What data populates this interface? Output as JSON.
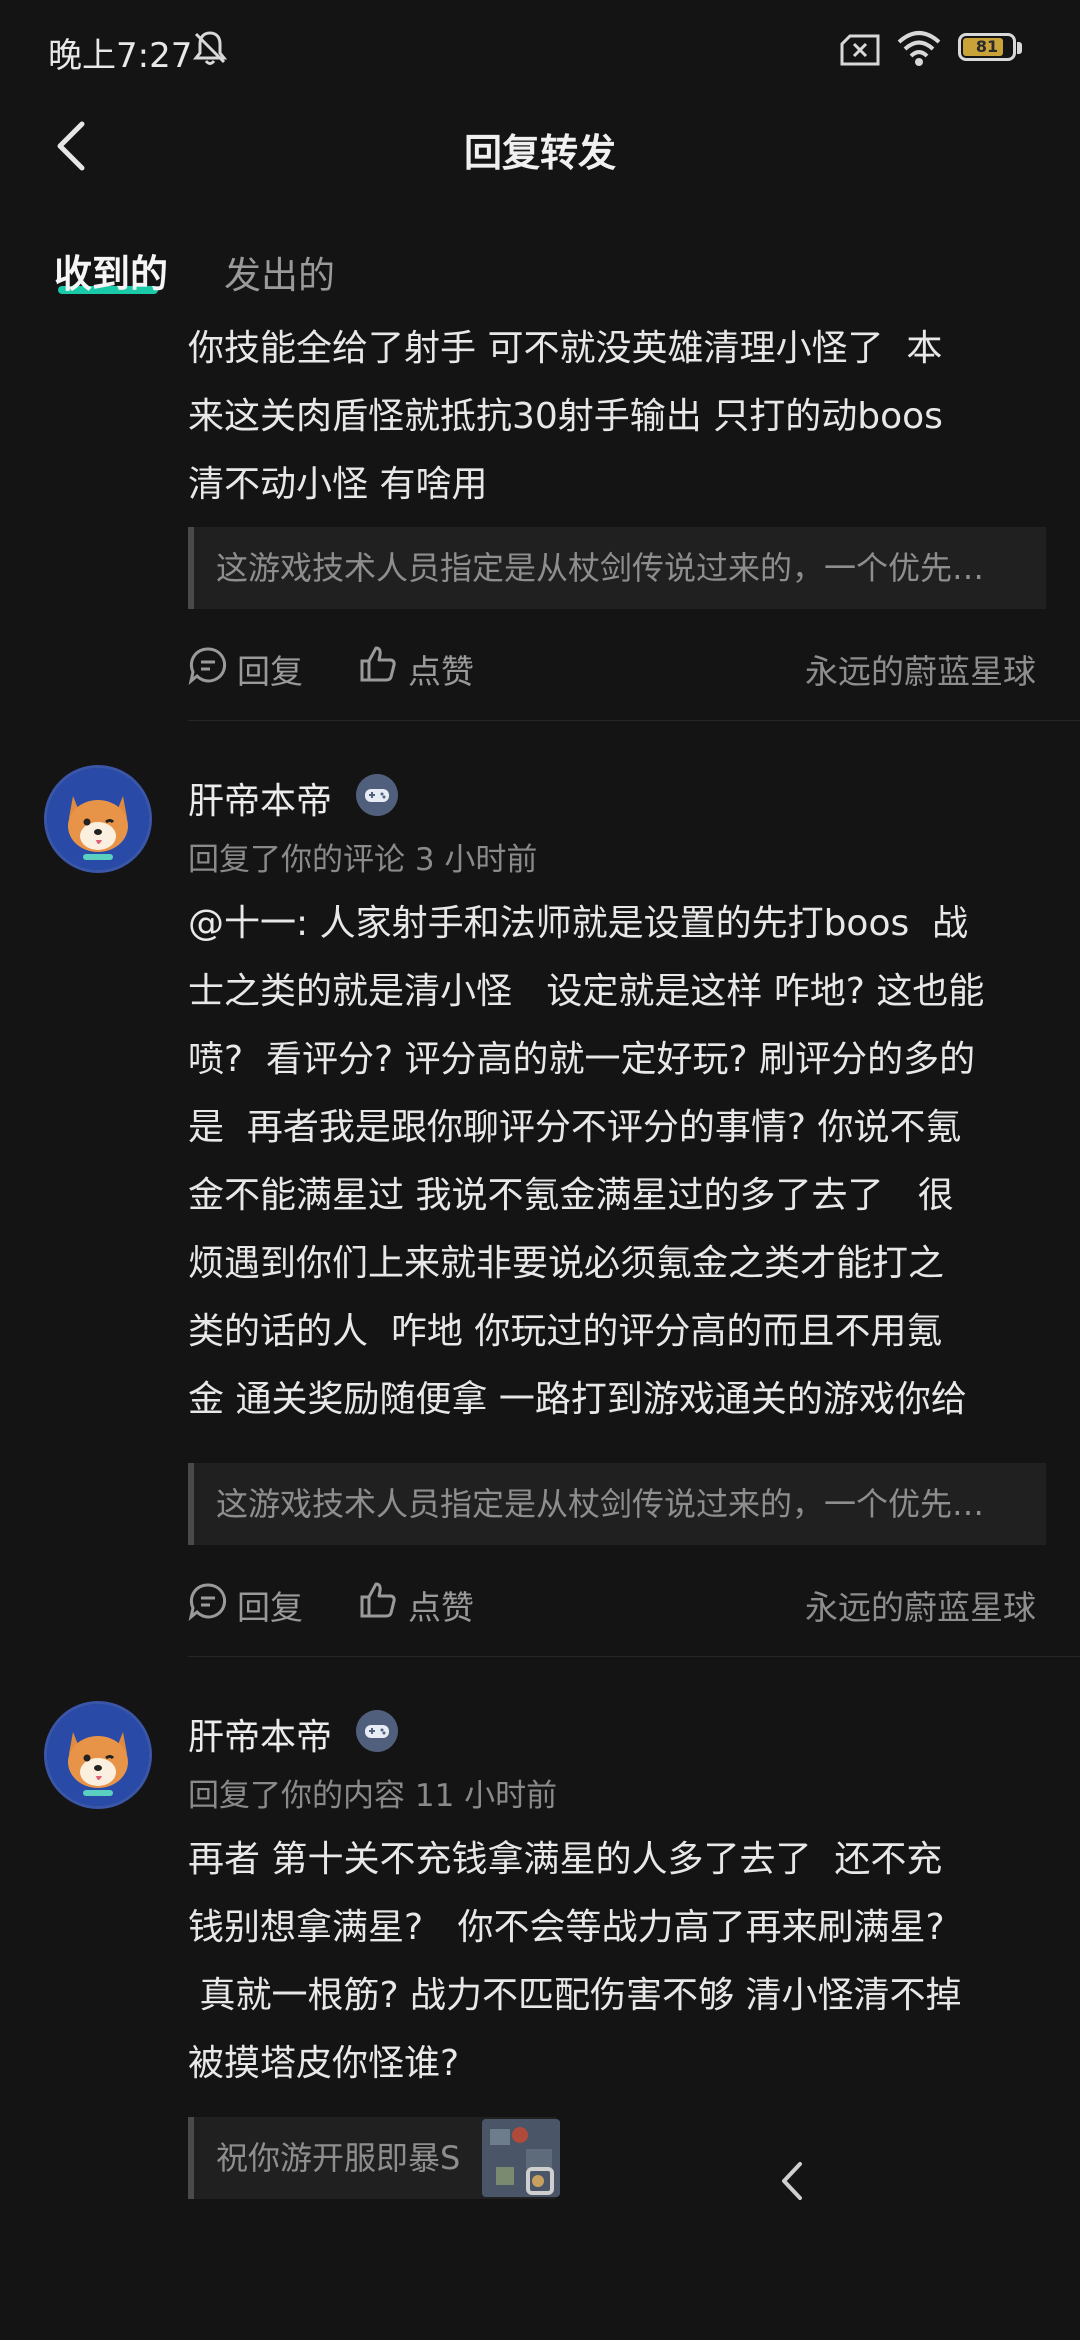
{
  "status_bar": {
    "time": "晚上7:27",
    "battery": "81"
  },
  "header": {
    "title": "回复转发"
  },
  "tabs": {
    "received": "收到的",
    "sent": "发出的"
  },
  "actions": {
    "reply": "回复",
    "like": "点赞"
  },
  "comments": [
    {
      "text": "你技能全给了射手 可不就没英雄清理小怪了  本\n来这关肉盾怪就抵抗30射手输出 只打的动boos\n清不动小怪 有啥用",
      "quote": "这游戏技术人员指定是从杖剑传说过来的，一个优先…",
      "author": "永远的蔚蓝星球"
    },
    {
      "username": "肝帝本帝",
      "meta": "回复了你的评论 3 小时前",
      "text": "@十一: 人家射手和法师就是设置的先打boos  战\n士之类的就是清小怪   设定就是这样 咋地? 这也能\n喷?  看评分? 评分高的就一定好玩? 刷评分的多的\n是  再者我是跟你聊评分不评分的事情? 你说不氪\n金不能满星过 我说不氪金满星过的多了去了   很\n烦遇到你们上来就非要说必须氪金之类才能打之\n类的话的人  咋地 你玩过的评分高的而且不用氪\n金 通关奖励随便拿 一路打到游戏通关的游戏你给",
      "quote": "这游戏技术人员指定是从杖剑传说过来的，一个优先…",
      "author": "永远的蔚蓝星球"
    },
    {
      "username": "肝帝本帝",
      "meta": "回复了你的内容 11 小时前",
      "text": "再者 第十关不充钱拿满星的人多了去了  还不充\n钱别想拿满星?   你不会等战力高了再来刷满星?\n 真就一根筋? 战力不匹配伤害不够 清小怪清不掉\n被摸塔皮你怪谁?",
      "quote": "祝你游开服即暴S"
    }
  ]
}
